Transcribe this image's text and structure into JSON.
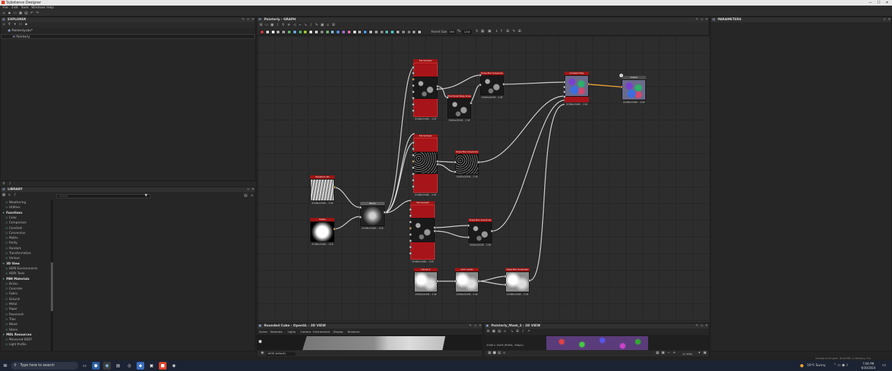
{
  "window": {
    "title": "Substance Designer",
    "controls": [
      "—",
      "☐",
      "✕"
    ]
  },
  "menu": [
    "File",
    "Edit",
    "Tools",
    "Windows",
    "Help"
  ],
  "explorer": {
    "title": "EXPLORER",
    "package": "Painterly.sbs*",
    "graph": "Painterly"
  },
  "library": {
    "title": "LIBRARY",
    "search_placeholder": "Search",
    "items": [
      {
        "label": "Weathering",
        "cat": false
      },
      {
        "label": "Utilities",
        "cat": false
      },
      {
        "label": "Functions",
        "cat": true
      },
      {
        "label": "Color",
        "cat": false
      },
      {
        "label": "Comparison",
        "cat": false
      },
      {
        "label": "Constant",
        "cat": false
      },
      {
        "label": "Conversion",
        "cat": false
      },
      {
        "label": "Maths",
        "cat": false
      },
      {
        "label": "Parity",
        "cat": false
      },
      {
        "label": "Random",
        "cat": false
      },
      {
        "label": "Transformation",
        "cat": false
      },
      {
        "label": "Various",
        "cat": false
      },
      {
        "label": "3D View",
        "cat": true
      },
      {
        "label": "HDRI Environments",
        "cat": false
      },
      {
        "label": "HDRI Tools",
        "cat": false
      },
      {
        "label": "PBR Materials",
        "cat": true
      },
      {
        "label": "Bricks",
        "cat": false
      },
      {
        "label": "Concrete",
        "cat": false
      },
      {
        "label": "Fabric",
        "cat": false
      },
      {
        "label": "Ground",
        "cat": false
      },
      {
        "label": "Metal",
        "cat": false
      },
      {
        "label": "Paper",
        "cat": false
      },
      {
        "label": "Pavement",
        "cat": false
      },
      {
        "label": "Tiles",
        "cat": false
      },
      {
        "label": "Wood",
        "cat": false
      },
      {
        "label": "Stone",
        "cat": false
      },
      {
        "label": "MDL Resources",
        "cat": true
      },
      {
        "label": "Measured BSDF",
        "cat": false
      },
      {
        "label": "Light Profile",
        "cat": false
      }
    ]
  },
  "graph": {
    "title": "Painterly - GRAPH",
    "parent_size_label": "Parent Size:",
    "parent_size": "256",
    "zoom": "1/16",
    "nodes": [
      {
        "id": "n1",
        "title": "Transform 2D",
        "size": "2048x2048 - 116"
      },
      {
        "id": "n2",
        "title": "Shape",
        "size": "2048x2048 - 116"
      },
      {
        "id": "n3",
        "title": "Bevel",
        "size": "2048x2048 - 116"
      },
      {
        "id": "n4",
        "title": "Tile Sampler",
        "size": "2048x2048 - 116"
      },
      {
        "id": "n5",
        "title": "Directional Warp Grayscale",
        "size": "2048x2048 - 116"
      },
      {
        "id": "n6",
        "title": "Slope Blur Grayscale",
        "size": "2048x2048 - 116"
      },
      {
        "id": "n7",
        "title": "Tile Sampler",
        "size": "2048x2048 - 116"
      },
      {
        "id": "n8",
        "title": "Slope Blur Grayscale",
        "size": "2048x2048 - 116"
      },
      {
        "id": "n9",
        "title": "Tile Sampler",
        "size": "2048x2048 - 116"
      },
      {
        "id": "n10",
        "title": "Slope Blur Grayscale",
        "size": "2048x2048 - 116"
      },
      {
        "id": "n11",
        "title": "Clouds 2",
        "size": "2048x2048 - 116"
      },
      {
        "id": "n12",
        "title": "Auto Levels",
        "size": "2048x2048 - 116"
      },
      {
        "id": "n13",
        "title": "Slope Blur Grayscale",
        "size": "2048x2048 - 116"
      },
      {
        "id": "n14",
        "title": "Gradient Map",
        "size": "2048x2048 - 116"
      },
      {
        "id": "n15",
        "title": "Output",
        "size": "2048x2048 - 116"
      }
    ]
  },
  "parameters": {
    "title": "PARAMETERS"
  },
  "view3d": {
    "title": "Rounded Cube - OpenGL - 3D VIEW",
    "menu": [
      "Scene",
      "Materials",
      "Lights",
      "Camera",
      "Environment",
      "Display",
      "Renderer"
    ],
    "bottom_label": "sRGB (default)"
  },
  "view2d": {
    "title": "Painterly_Mask_2 - 2D VIEW",
    "info": "2048 x 2048 (RGBA, 16bpc)",
    "zoom": "11.99%"
  },
  "status": {
    "text": "Substance Engine: Direct3D 11  Memory: 0%"
  },
  "taskbar": {
    "search_placeholder": "Type here to search",
    "weather": "19°C  Sunny",
    "time": "7:06 PM",
    "date": "9/30/2024"
  },
  "colors": {
    "accent": "#f2a531",
    "node_red": "#a71419",
    "titlebar": "#e7e7e7"
  }
}
